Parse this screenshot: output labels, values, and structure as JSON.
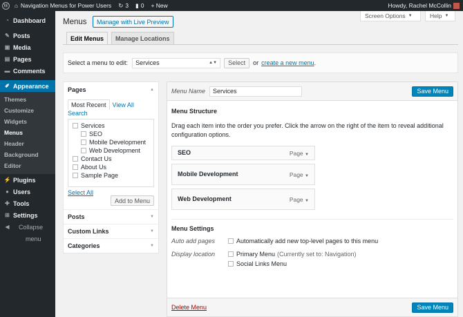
{
  "adminbar": {
    "site": "Navigation Menus for Power Users",
    "updates": "3",
    "comments": "0",
    "new": "+ New",
    "howdy": "Howdy, Rachel McCollin"
  },
  "sidebar": {
    "dashboard": "Dashboard",
    "posts": "Posts",
    "media": "Media",
    "pages": "Pages",
    "comments": "Comments",
    "appearance": "Appearance",
    "sub": [
      "Themes",
      "Customize",
      "Widgets",
      "Menus",
      "Header",
      "Background",
      "Editor"
    ],
    "plugins": "Plugins",
    "users": "Users",
    "tools": "Tools",
    "settings": "Settings",
    "collapse": "Collapse",
    "collapse2": "menu"
  },
  "header": {
    "screen_options": "Screen Options",
    "help": "Help",
    "title": "Menus",
    "live_preview": "Manage with Live Preview",
    "tab_edit": "Edit Menus",
    "tab_locations": "Manage Locations"
  },
  "manage": {
    "label": "Select a menu to edit:",
    "selected": "Services",
    "select_btn": "Select",
    "or": "or",
    "create_link": "create a new menu",
    "period": "."
  },
  "pages_box": {
    "title": "Pages",
    "tab_recent": "Most Recent",
    "tab_all": "View All",
    "search": "Search",
    "items": [
      "Services",
      "SEO",
      "Mobile Development",
      "Web Development",
      "Contact Us",
      "About Us",
      "Sample Page"
    ],
    "select_all": "Select All",
    "add": "Add to Menu"
  },
  "accordion": [
    "Posts",
    "Custom Links",
    "Categories"
  ],
  "menu_edit": {
    "name_label": "Menu Name",
    "name_value": "Services",
    "save": "Save Menu",
    "structure_title": "Menu Structure",
    "instructions": "Drag each item into the order you prefer. Click the arrow on the right of the item to reveal additional configuration options.",
    "items": [
      {
        "title": "SEO",
        "type": "Page"
      },
      {
        "title": "Mobile Development",
        "type": "Page"
      },
      {
        "title": "Web Development",
        "type": "Page"
      }
    ],
    "settings_title": "Menu Settings",
    "auto_label": "Auto add pages",
    "auto_text": "Automatically add new top-level pages to this menu",
    "display_label": "Display location",
    "primary": "Primary Menu",
    "primary_note": "(Currently set to: Navigation)",
    "social": "Social Links Menu",
    "delete": "Delete Menu"
  }
}
